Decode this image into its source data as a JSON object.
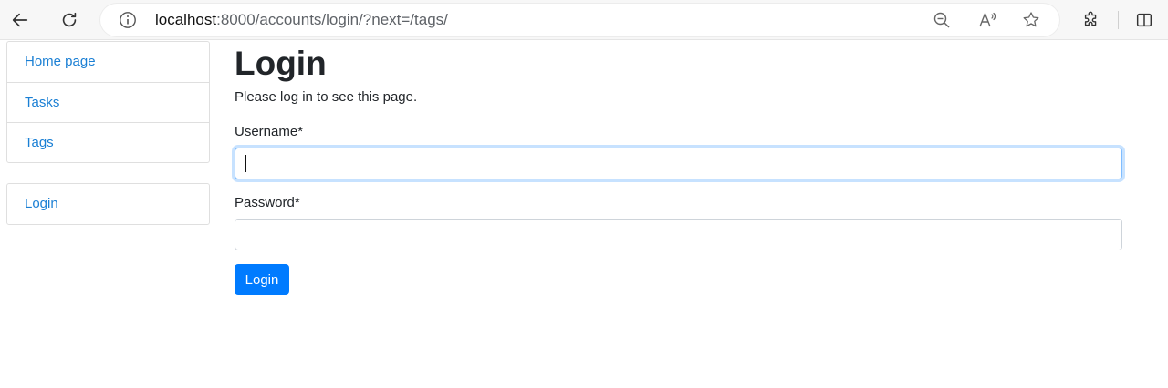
{
  "browser": {
    "url_host": "localhost",
    "url_rest": ":8000/accounts/login/?next=/tags/"
  },
  "sidebar": {
    "nav_items": [
      {
        "label": "Home page"
      },
      {
        "label": "Tasks"
      },
      {
        "label": "Tags"
      }
    ],
    "auth_items": [
      {
        "label": "Login"
      }
    ]
  },
  "main": {
    "title": "Login",
    "message": "Please log in to see this page.",
    "username_label": "Username*",
    "username_value": "",
    "password_label": "Password*",
    "password_value": "",
    "submit_label": "Login"
  },
  "colors": {
    "link": "#1a7fd4",
    "primary": "#007bff",
    "focus_border": "#80bdff"
  }
}
